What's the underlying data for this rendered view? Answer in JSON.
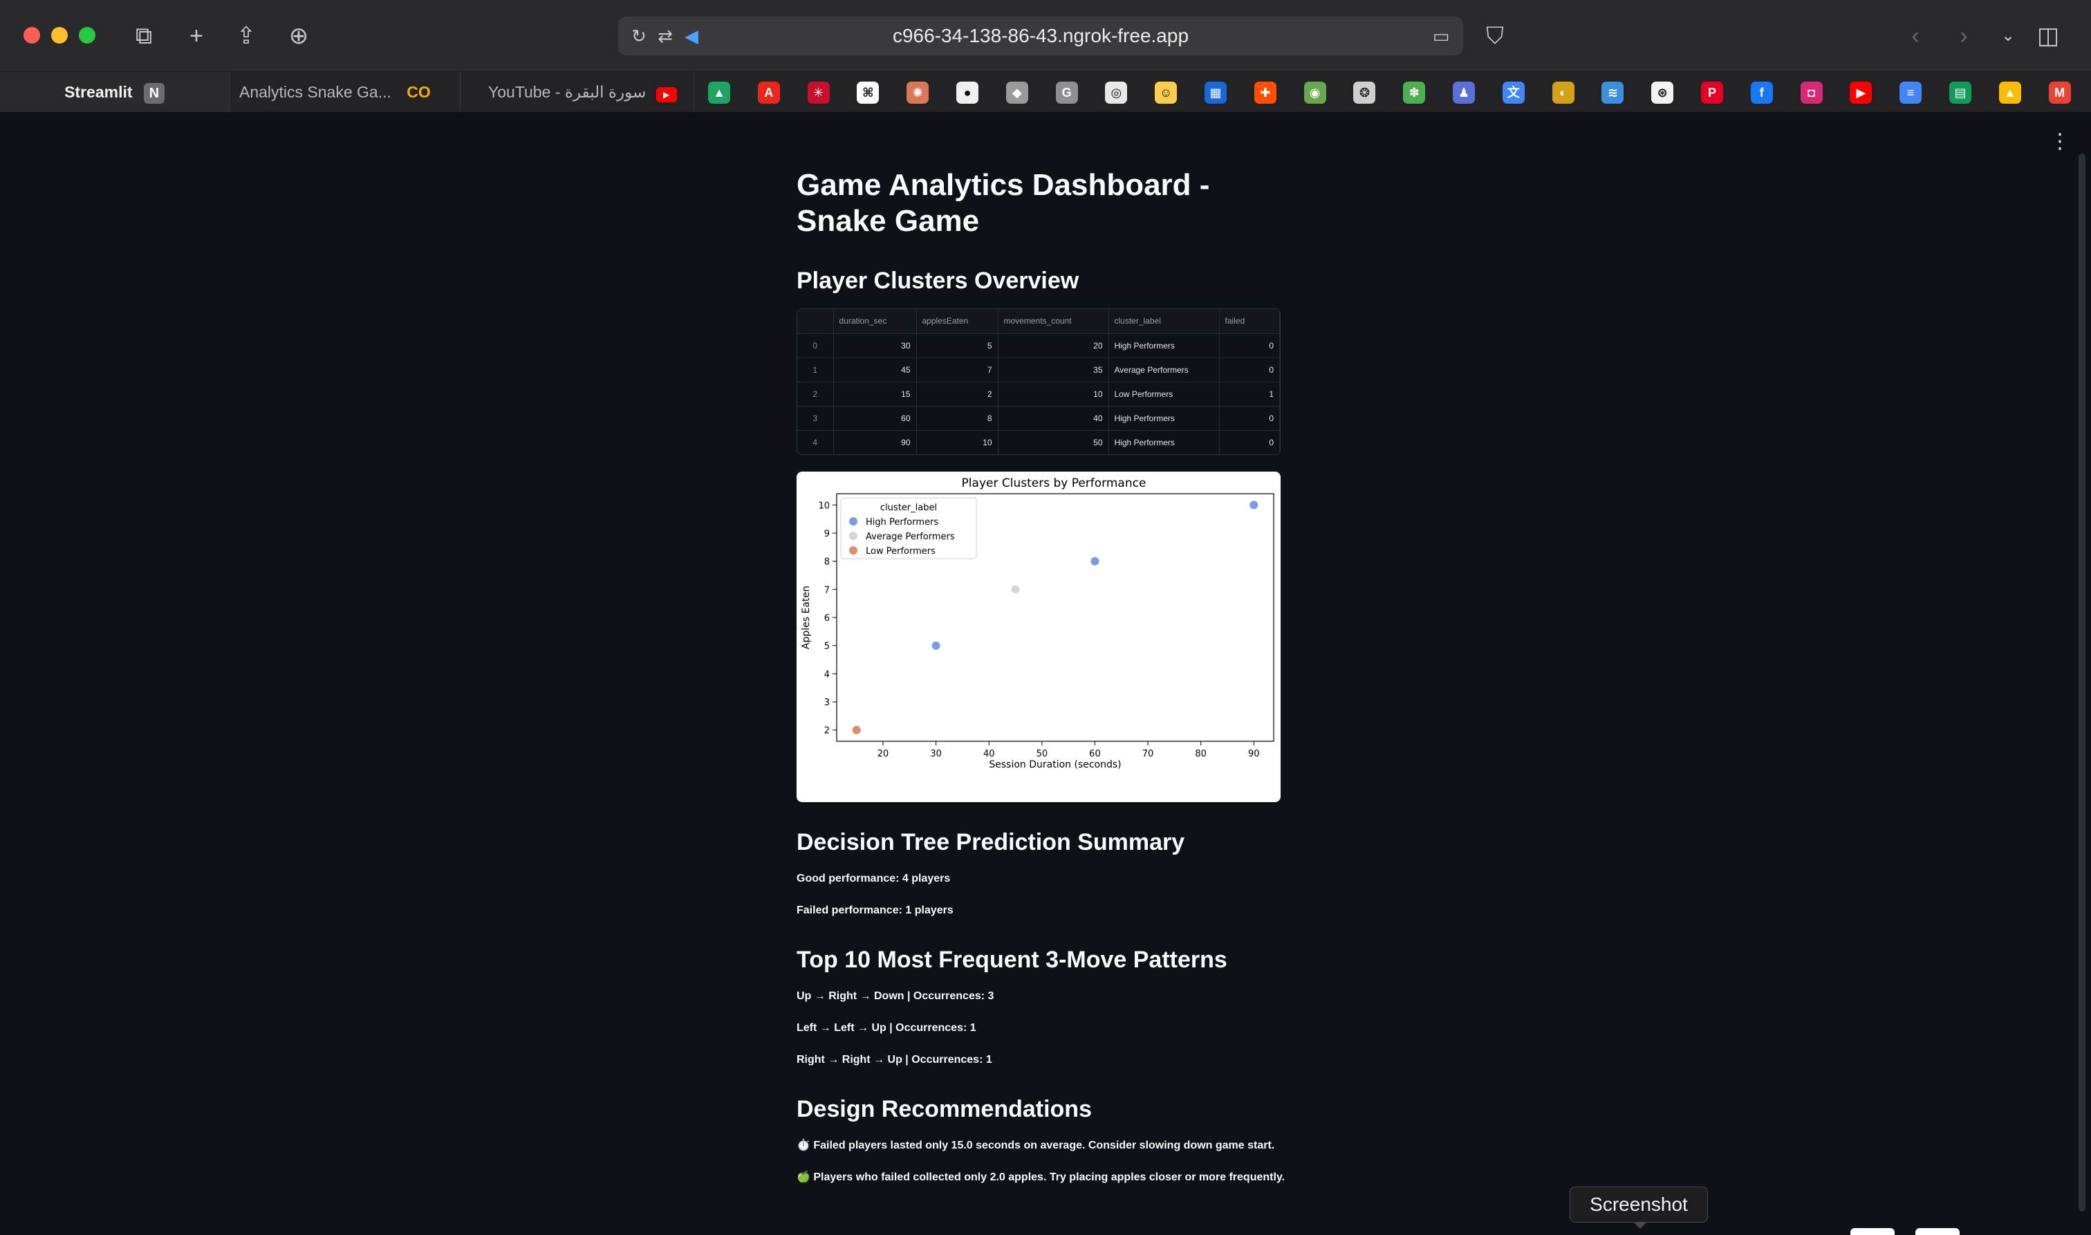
{
  "browser": {
    "url": "c966-34-138-86-43.ngrok-free.app",
    "tabs": [
      {
        "label": "Streamlit",
        "badge": "N"
      },
      {
        "label": "Analytics Snake Ga...",
        "badge": "CO"
      },
      {
        "label": "YouTube - سورة البقرة",
        "badge": "▶"
      }
    ],
    "favicons": [
      {
        "icon": "google-drive-icon",
        "color": "#1fa463",
        "glyph": "▲"
      },
      {
        "icon": "adobe-icon",
        "color": "#e8261c",
        "glyph": "A"
      },
      {
        "icon": "red-app-icon",
        "color": "#c8102e",
        "glyph": "✳"
      },
      {
        "icon": "grid-app-icon",
        "color": "#ffffff",
        "glyph": "⌘"
      },
      {
        "icon": "claude-icon",
        "color": "#d97757",
        "glyph": "✺"
      },
      {
        "icon": "github-icon",
        "color": "#f0f0f0",
        "glyph": "●"
      },
      {
        "icon": "unity-icon",
        "color": "#9a9a9a",
        "glyph": "◆"
      },
      {
        "icon": "g-icon",
        "color": "#8e8e93",
        "glyph": "G"
      },
      {
        "icon": "chatgpt-icon",
        "color": "#e8e8e8",
        "glyph": "◎"
      },
      {
        "icon": "huggingface-icon",
        "color": "#ffcc4d",
        "glyph": "☺"
      },
      {
        "icon": "trello-icon",
        "color": "#1868db",
        "glyph": "▦"
      },
      {
        "icon": "zapier-icon",
        "color": "#ff4f00",
        "glyph": "✚"
      },
      {
        "icon": "globe-icon",
        "color": "#6aa84f",
        "glyph": "◉"
      },
      {
        "icon": "owl-icon",
        "color": "#cfcfcf",
        "glyph": "❂"
      },
      {
        "icon": "tensor-icon",
        "color": "#4caf50",
        "glyph": "✽"
      },
      {
        "icon": "figure-icon",
        "color": "#5b6fd6",
        "glyph": "♟"
      },
      {
        "icon": "google-translate-icon",
        "color": "#4285f4",
        "glyph": "文"
      },
      {
        "icon": "eye-icon",
        "color": "#d4a017",
        "glyph": "◐"
      },
      {
        "icon": "vscode-icon",
        "color": "#3e8ede",
        "glyph": "≋"
      },
      {
        "icon": "openai-icon",
        "color": "#f2f2f2",
        "glyph": "⊛"
      },
      {
        "icon": "pinterest-icon",
        "color": "#e60023",
        "glyph": "P"
      },
      {
        "icon": "facebook-icon",
        "color": "#1877f2",
        "glyph": "f"
      },
      {
        "icon": "instagram-icon",
        "color": "#d62976",
        "glyph": "◘"
      },
      {
        "icon": "youtube-icon",
        "color": "#ff0000",
        "glyph": "▶"
      },
      {
        "icon": "google-docs-icon",
        "color": "#4285f4",
        "glyph": "≡"
      },
      {
        "icon": "google-sheets-icon",
        "color": "#0f9d58",
        "glyph": "▤"
      },
      {
        "icon": "google-drive-icon-2",
        "color": "#fbbc04",
        "glyph": "▲"
      },
      {
        "icon": "gmail-icon",
        "color": "#ea4335",
        "glyph": "M"
      }
    ]
  },
  "page": {
    "title": "Game Analytics Dashboard - Snake Game",
    "clusters_heading": "Player Clusters Overview",
    "table": {
      "columns": [
        "",
        "duration_sec",
        "applesEaten",
        "movements_count",
        "cluster_label",
        "failed"
      ],
      "rows": [
        [
          "0",
          "30",
          "5",
          "20",
          "High Performers",
          "0"
        ],
        [
          "1",
          "45",
          "7",
          "35",
          "Average Performers",
          "0"
        ],
        [
          "2",
          "15",
          "2",
          "10",
          "Low Performers",
          "1"
        ],
        [
          "3",
          "60",
          "8",
          "40",
          "High Performers",
          "0"
        ],
        [
          "4",
          "90",
          "10",
          "50",
          "High Performers",
          "0"
        ]
      ]
    },
    "decision_heading": "Decision Tree Prediction Summary",
    "decision_lines": [
      "Good performance: 4 players",
      "Failed performance: 1 players"
    ],
    "patterns_heading": "Top 10 Most Frequent 3-Move Patterns",
    "patterns": [
      "Up → Right → Down | Occurrences: 3",
      "Left → Left → Up | Occurrences: 1",
      "Right → Right → Up | Occurrences: 1"
    ],
    "design_heading": "Design Recommendations",
    "recommendations": [
      "⏱️ Failed players lasted only 15.0 seconds on average. Consider slowing down game start.",
      "🍏 Players who failed collected only 2.0 apples. Try placing apples closer or more frequently."
    ],
    "tooltip": "Screenshot"
  },
  "chart_data": {
    "type": "scatter",
    "title": "Player Clusters by Performance",
    "xlabel": "Session Duration (seconds)",
    "ylabel": "Apples Eaten",
    "xlim": [
      11.25,
      93.75
    ],
    "ylim": [
      1.6,
      10.4
    ],
    "xticks": [
      20,
      30,
      40,
      50,
      60,
      70,
      80,
      90
    ],
    "yticks": [
      2,
      3,
      4,
      5,
      6,
      7,
      8,
      9,
      10
    ],
    "grid": false,
    "legend": {
      "title": "cluster_label",
      "placement": "top-left"
    },
    "series": [
      {
        "name": "High Performers",
        "color": "#7b9be6",
        "points": [
          [
            30,
            5
          ],
          [
            60,
            8
          ],
          [
            90,
            10
          ]
        ]
      },
      {
        "name": "Average Performers",
        "color": "#d6d6d6",
        "points": [
          [
            45,
            7
          ]
        ]
      },
      {
        "name": "Low Performers",
        "color": "#e08a68",
        "points": [
          [
            15,
            2
          ]
        ]
      }
    ]
  }
}
